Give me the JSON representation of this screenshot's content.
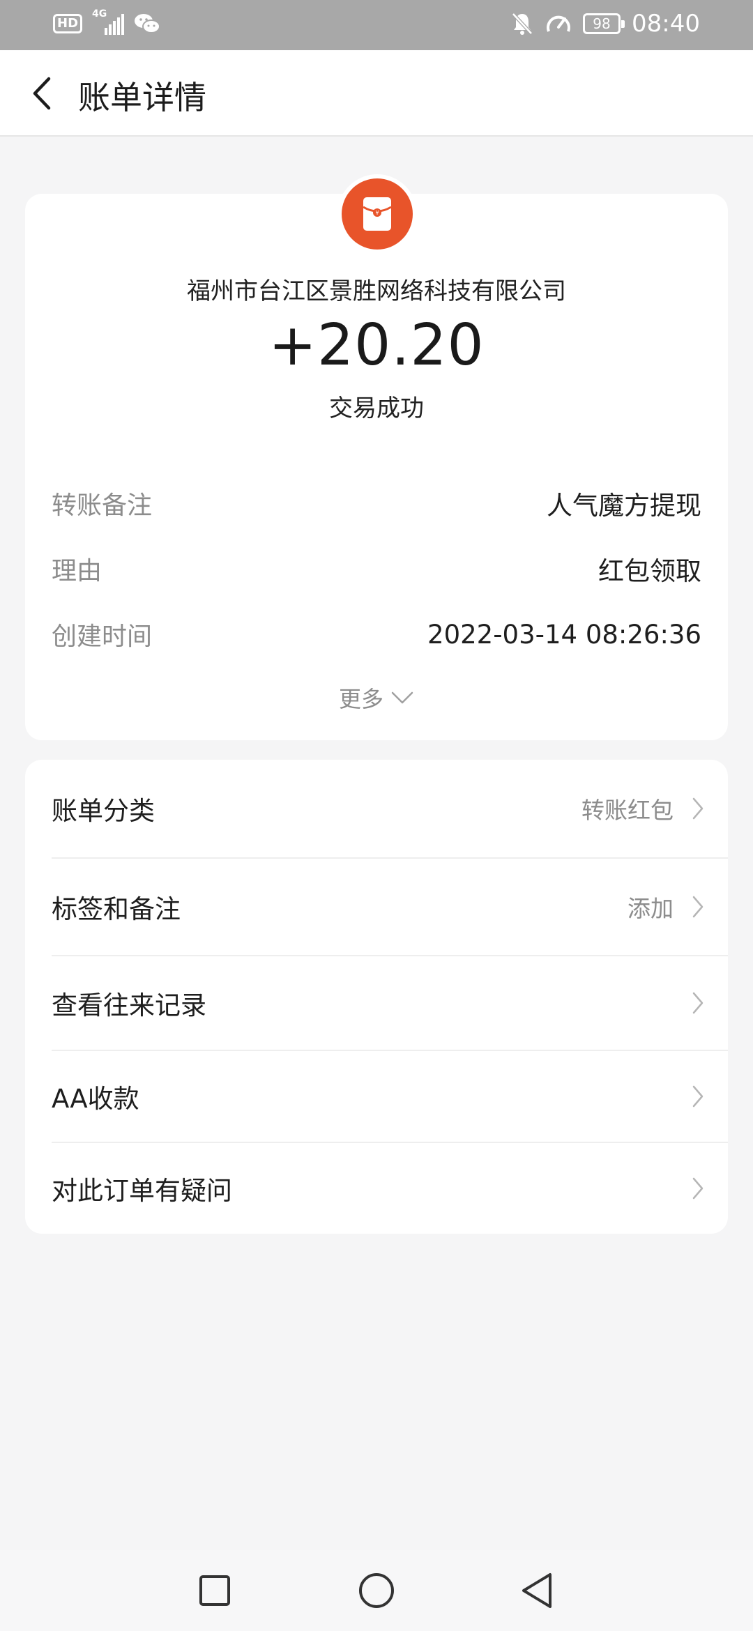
{
  "status_bar": {
    "hd": "HD",
    "network": "4G",
    "battery": "98",
    "time": "08:40",
    "icons": [
      "signal-icon",
      "wechat-icon",
      "mute-bell-icon",
      "speedometer-icon",
      "battery-icon"
    ]
  },
  "header": {
    "title": "账单详情",
    "back_icon": "chevron-left-icon"
  },
  "transaction": {
    "icon": "red-packet-icon",
    "icon_color": "#e8542a",
    "merchant": "福州市台江区景胜网络科技有限公司",
    "amount": "+20.20",
    "status": "交易成功",
    "details": [
      {
        "label": "转账备注",
        "value": "人气魔方提现"
      },
      {
        "label": "理由",
        "value": "红包领取"
      },
      {
        "label": "创建时间",
        "value": "2022-03-14 08:26:36"
      }
    ],
    "more_label": "更多"
  },
  "menu": [
    {
      "label": "账单分类",
      "value": "转账红包"
    },
    {
      "label": "标签和备注",
      "value": "添加"
    },
    {
      "label": "查看往来记录",
      "value": ""
    },
    {
      "label": "AA收款",
      "value": ""
    },
    {
      "label": "对此订单有疑问",
      "value": ""
    }
  ],
  "nav_bar": {
    "icons": [
      "recent-apps-icon",
      "home-icon",
      "back-triangle-icon"
    ]
  }
}
